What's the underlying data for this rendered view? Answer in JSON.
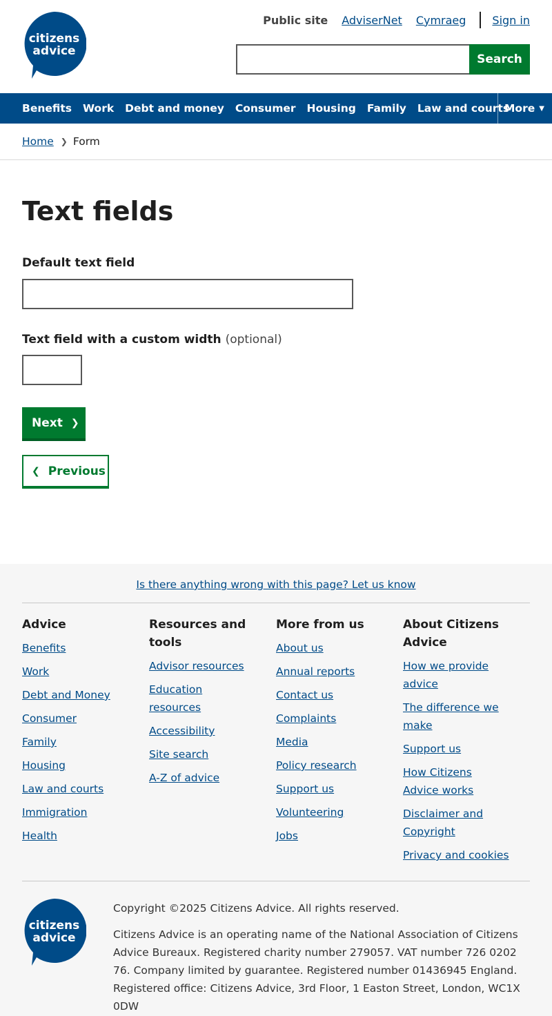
{
  "brand": {
    "logo_line1": "citizens",
    "logo_line2": "advice",
    "color": "#004b88"
  },
  "toplinks": {
    "current": "Public site",
    "adviser": "AdviserNet",
    "welsh": "Cymraeg",
    "signin": "Sign in"
  },
  "search": {
    "placeholder": "",
    "button": "Search"
  },
  "nav": {
    "items": [
      "Benefits",
      "Work",
      "Debt and money",
      "Consumer",
      "Housing",
      "Family",
      "Law and courts"
    ],
    "more": "More"
  },
  "breadcrumb": {
    "home": "Home",
    "current": "Form"
  },
  "page": {
    "title": "Text fields",
    "field1_label": "Default text field",
    "field1_value": "",
    "field2_label": "Text field with a custom width",
    "field2_optional": "(optional)",
    "field2_value": "",
    "next": "Next",
    "previous": "Previous"
  },
  "footer": {
    "report": "Is there anything wrong with this page? Let us know",
    "cols": [
      {
        "heading": "Advice",
        "links": [
          "Benefits",
          "Work",
          "Debt and Money",
          "Consumer",
          "Family",
          "Housing",
          "Law and courts",
          "Immigration",
          "Health"
        ]
      },
      {
        "heading": "Resources and tools",
        "links": [
          "Advisor resources",
          "Education resources",
          "Accessibility",
          "Site search",
          "A-Z of advice"
        ]
      },
      {
        "heading": "More from us",
        "links": [
          "About us",
          "Annual reports",
          "Contact us",
          "Complaints",
          "Media",
          "Policy research",
          "Support us",
          "Volunteering",
          "Jobs"
        ]
      },
      {
        "heading": "About Citizens Advice",
        "links": [
          "How we provide advice",
          "The difference we make",
          "Support us",
          "How Citizens Advice works",
          "Disclaimer and Copyright",
          "Privacy and cookies"
        ]
      }
    ],
    "copyright": "Copyright ©2025 Citizens Advice. All rights reserved.",
    "legal": "Citizens Advice is an operating name of the National Association of Citizens Advice Bureaux. Registered charity number 279057. VAT number 726 0202 76. Company limited by guarantee. Registered number 01436945 England. Registered office: Citizens Advice, 3rd Floor, 1 Easton Street, London, WC1X 0DW"
  }
}
